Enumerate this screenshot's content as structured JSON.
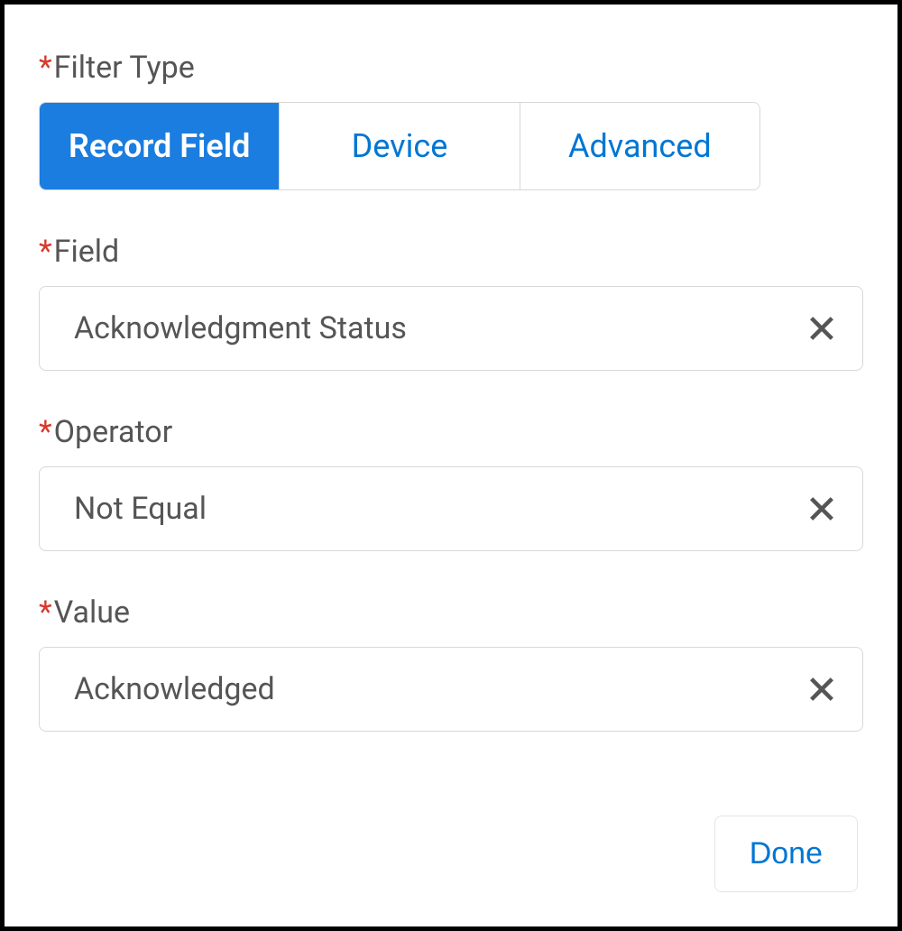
{
  "filterType": {
    "label": "Filter Type",
    "options": {
      "recordField": "Record Field",
      "device": "Device",
      "advanced": "Advanced"
    },
    "selected": "recordField"
  },
  "field": {
    "label": "Field",
    "value": "Acknowledgment Status"
  },
  "operator": {
    "label": "Operator",
    "value": "Not Equal"
  },
  "value": {
    "label": "Value",
    "value": "Acknowledged"
  },
  "buttons": {
    "done": "Done"
  }
}
